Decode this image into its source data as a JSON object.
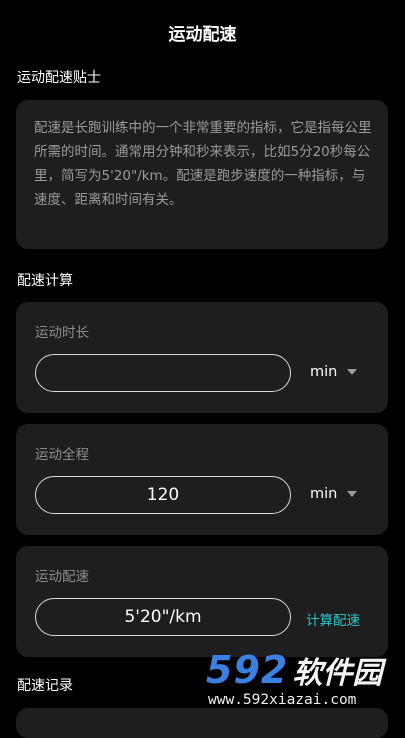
{
  "header": {
    "title": "运动配速"
  },
  "tips": {
    "heading": "运动配速贴士",
    "body": "配速是长跑训练中的一个非常重要的指标，它是指每公里所需的时间。通常用分钟和秒来表示，比如5分20秒每公里，简写为5'20\"/km。配速是跑步速度的一种指标，与速度、距离和时间有关。"
  },
  "calculator": {
    "heading": "配速计算",
    "duration": {
      "label": "运动时长",
      "value": "",
      "unit": "min"
    },
    "distance": {
      "label": "运动全程",
      "value": "120",
      "unit": "min"
    },
    "pace": {
      "label": "运动配速",
      "value": "5'20\"/km",
      "action": "计算配速"
    }
  },
  "records": {
    "heading": "配速记录"
  },
  "watermark": {
    "number": "592",
    "name": "软件园",
    "url": "www.592xiazai.com"
  },
  "colors": {
    "background": "#000000",
    "card": "#1e1e1e",
    "accent": "#2bc6c9",
    "muted": "#8c8c8c"
  }
}
